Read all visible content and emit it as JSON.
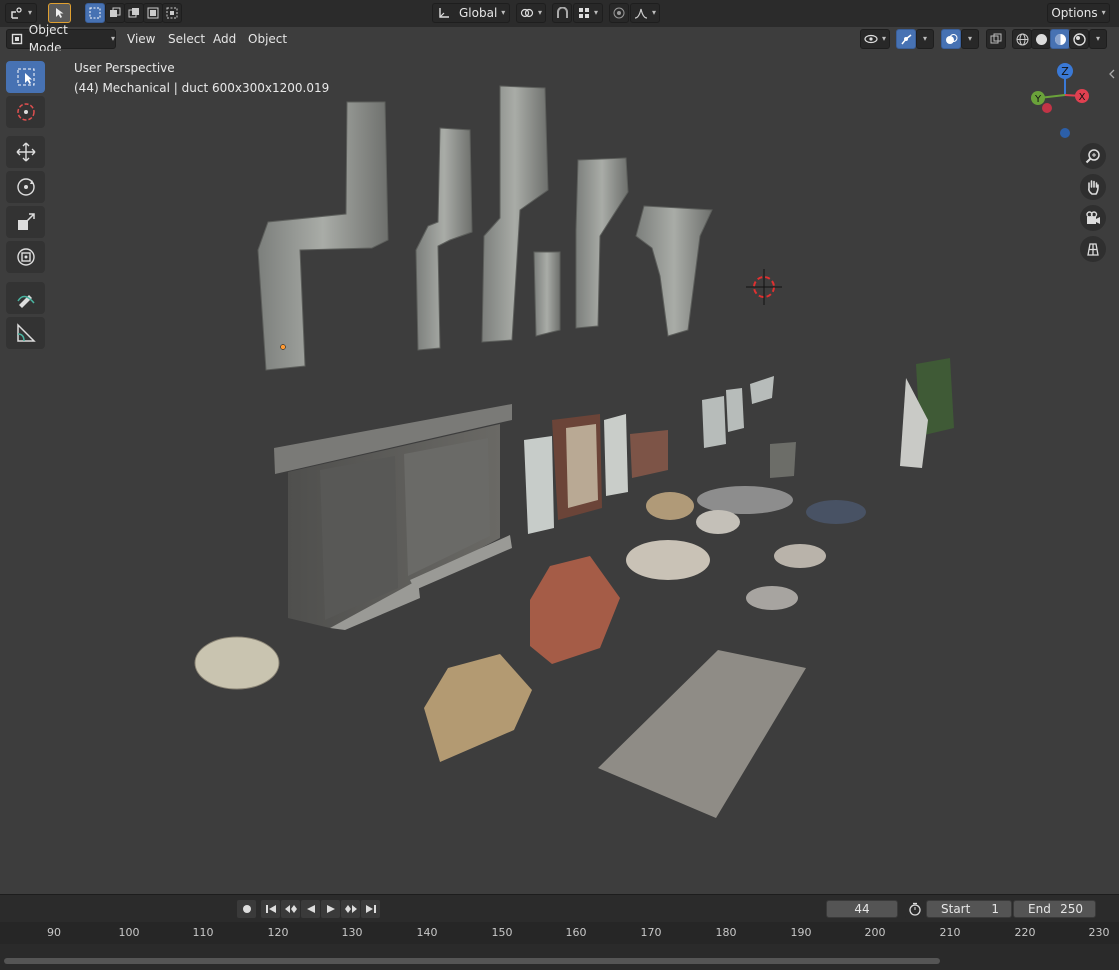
{
  "header": {
    "transform_orientation": "Global",
    "options_label": "Options"
  },
  "view_header": {
    "mode": "Object Mode",
    "menus": [
      "View",
      "Select",
      "Add",
      "Object"
    ]
  },
  "viewport": {
    "perspective_label": "User Perspective",
    "object_info": "(44) Mechanical | duct 600x300x1200.019",
    "gizmo_axes": [
      "Z",
      "Y",
      "X"
    ]
  },
  "timeline": {
    "current_frame": "44",
    "start_label": "Start",
    "start_value": "1",
    "end_label": "End",
    "end_value": "250",
    "ruler_ticks": [
      "90",
      "100",
      "110",
      "120",
      "130",
      "140",
      "150",
      "160",
      "170",
      "180",
      "190",
      "200",
      "210",
      "220",
      "230"
    ]
  },
  "colors": {
    "accent": "#4772b3",
    "axis_x": "#e04050",
    "axis_y": "#6aa23a",
    "axis_z": "#3a79d6",
    "background": "#3d3d3d"
  },
  "icons": [
    "editor-type-icon",
    "select-box-icon",
    "cursor-icon",
    "move-icon",
    "rotate-icon",
    "scale-icon",
    "transform-icon",
    "annotate-icon",
    "measure-icon",
    "zoom-icon",
    "hand-icon",
    "camera-icon",
    "grid-icon",
    "snap-icon",
    "proportional-icon",
    "visibility-icon",
    "gizmo-icon",
    "overlay-icon",
    "xray-icon",
    "wireframe-icon",
    "solid-icon",
    "material-icon",
    "rendered-icon",
    "record-icon",
    "stopwatch-icon"
  ]
}
